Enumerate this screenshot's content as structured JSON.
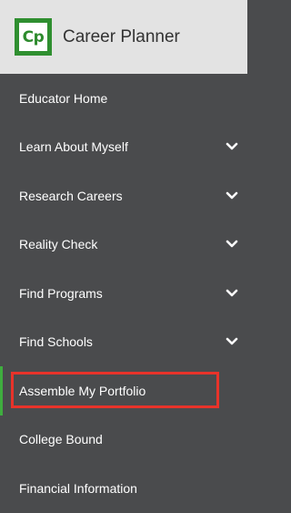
{
  "header": {
    "logo_text": "Cp",
    "title": "Career Planner"
  },
  "menu": {
    "items": [
      {
        "label": "Educator Home",
        "has_chevron": false
      },
      {
        "label": "Learn About Myself",
        "has_chevron": true
      },
      {
        "label": "Research Careers",
        "has_chevron": true
      },
      {
        "label": "Reality Check",
        "has_chevron": true
      },
      {
        "label": "Find Programs",
        "has_chevron": true
      },
      {
        "label": "Find Schools",
        "has_chevron": true
      },
      {
        "label": "Assemble My Portfolio",
        "has_chevron": false,
        "active": true,
        "highlighted": true
      },
      {
        "label": "College Bound",
        "has_chevron": false
      },
      {
        "label": "Financial Information",
        "has_chevron": false
      }
    ]
  },
  "colors": {
    "sidebar_bg": "#4a4b4d",
    "header_bg": "#e3e3e3",
    "brand_green": "#2f8f30",
    "active_indicator": "#3fae3f",
    "highlight_red": "#e8332a"
  },
  "icons": {
    "chevron": "chevron-down-icon",
    "logo": "career-planner-logo"
  }
}
